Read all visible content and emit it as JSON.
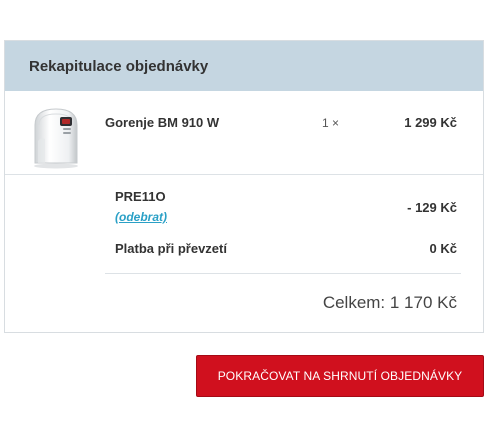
{
  "summary": {
    "title": "Rekapitulace objednávky"
  },
  "product": {
    "name": "Gorenje BM 910 W",
    "quantity": "1 ×",
    "price": "1 299 Kč",
    "image_icon": "bread-maker-product-image"
  },
  "coupon": {
    "code": "PRE11O",
    "remove_label": "(odebrat)",
    "discount": "- 129 Kč"
  },
  "payment": {
    "label": "Platba při převzetí",
    "price": "0 Kč"
  },
  "total": {
    "text": "Celkem: 1 170 Kč"
  },
  "actions": {
    "continue_label": "POKRAČOVAT NA SHRNUTÍ OBJEDNÁVKY"
  },
  "colors": {
    "header_bg": "#c5d6e1",
    "link": "#2aa0c6",
    "button_bg": "#d0101e"
  }
}
